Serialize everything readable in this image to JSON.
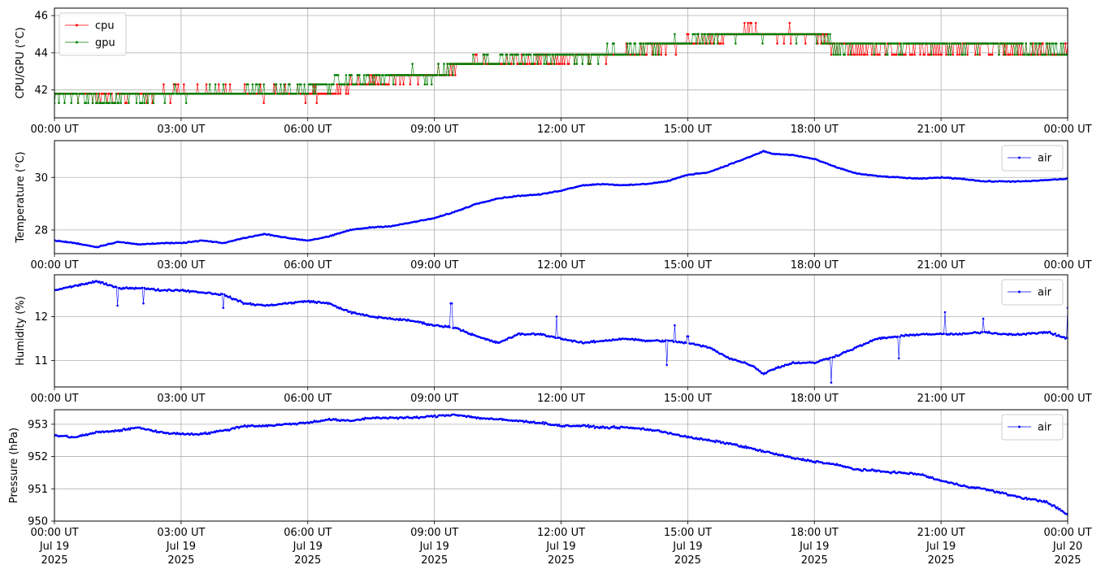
{
  "chart_data": [
    {
      "type": "line",
      "ylabel": "CPU/GPU (°C)",
      "xlim": [
        "2025-07-19 00:00",
        "2025-07-20 00:00"
      ],
      "ylim": [
        40.5,
        46.4
      ],
      "yticks": [
        "42",
        "44",
        "46"
      ],
      "xticks": [
        "00:00 UT",
        "03:00 UT",
        "06:00 UT",
        "09:00 UT",
        "12:00 UT",
        "15:00 UT",
        "18:00 UT",
        "21:00 UT",
        "00:00 UT"
      ],
      "grid": true,
      "legend_position": "upper-left",
      "series": [
        {
          "name": "cpu",
          "color": "#ff0000",
          "x_hours": [
            0,
            1,
            2,
            3,
            4,
            5,
            6,
            6.5,
            7,
            8,
            9,
            9.5,
            10,
            11,
            12,
            13,
            14,
            15,
            16,
            16.5,
            17,
            18,
            18.5,
            19,
            20,
            21,
            22,
            23,
            24
          ],
          "values": [
            41.8,
            41.6,
            41.7,
            41.9,
            41.9,
            41.8,
            41.8,
            41.8,
            42.4,
            42.6,
            42.8,
            43.2,
            43.5,
            43.6,
            43.7,
            43.8,
            44.2,
            44.6,
            44.9,
            45.2,
            45.0,
            45.0,
            44.3,
            44.2,
            44.2,
            44.2,
            44.3,
            44.1,
            44.1
          ],
          "range": [
            41.3,
            46.0
          ]
        },
        {
          "name": "gpu",
          "color": "#008000",
          "x_hours": [
            0,
            1,
            2,
            3,
            4,
            5,
            6,
            6.5,
            7,
            8,
            9,
            9.5,
            10,
            11,
            12,
            13,
            14,
            15,
            16,
            16.5,
            17,
            18,
            18.5,
            19,
            20,
            21,
            22,
            23,
            24
          ],
          "values": [
            41.7,
            41.5,
            41.6,
            41.8,
            41.9,
            42.0,
            42.0,
            42.3,
            42.5,
            42.7,
            42.8,
            43.3,
            43.6,
            43.7,
            43.8,
            43.9,
            44.3,
            44.7,
            45.0,
            45.0,
            45.0,
            45.0,
            44.3,
            44.3,
            44.4,
            44.4,
            44.4,
            44.3,
            44.1
          ],
          "range": [
            40.9,
            45.6
          ]
        }
      ]
    },
    {
      "type": "line",
      "ylabel": "Temperature (°C)",
      "xlim": [
        "2025-07-19 00:00",
        "2025-07-20 00:00"
      ],
      "ylim": [
        27.1,
        31.4
      ],
      "yticks": [
        "28",
        "30"
      ],
      "xticks": [
        "00:00 UT",
        "03:00 UT",
        "06:00 UT",
        "09:00 UT",
        "12:00 UT",
        "15:00 UT",
        "18:00 UT",
        "21:00 UT",
        "00:00 UT"
      ],
      "grid": true,
      "legend_position": "upper-right",
      "series": [
        {
          "name": "air",
          "color": "#0000ff",
          "x_hours": [
            0,
            0.5,
            1,
            1.5,
            2,
            2.5,
            3,
            3.5,
            4,
            4.5,
            5,
            5.5,
            6,
            6.5,
            7,
            7.5,
            8,
            8.5,
            9,
            9.5,
            10,
            10.5,
            11,
            11.5,
            12,
            12.5,
            13,
            13.5,
            14,
            14.5,
            15,
            15.5,
            16,
            16.5,
            16.8,
            17,
            17.5,
            18,
            18.5,
            19,
            19.5,
            20,
            20.5,
            21,
            21.5,
            22,
            22.5,
            23,
            23.5,
            24
          ],
          "values": [
            27.6,
            27.5,
            27.35,
            27.55,
            27.45,
            27.5,
            27.5,
            27.6,
            27.5,
            27.7,
            27.85,
            27.7,
            27.6,
            27.75,
            28.0,
            28.1,
            28.15,
            28.3,
            28.45,
            28.7,
            29.0,
            29.2,
            29.3,
            29.35,
            29.5,
            29.7,
            29.75,
            29.7,
            29.75,
            29.85,
            30.1,
            30.2,
            30.5,
            30.8,
            31.0,
            30.9,
            30.85,
            30.7,
            30.4,
            30.15,
            30.05,
            30.0,
            29.95,
            30.0,
            29.95,
            29.85,
            29.85,
            29.85,
            29.9,
            29.95
          ]
        }
      ]
    },
    {
      "type": "line",
      "ylabel": "Humidity (%)",
      "xlim": [
        "2025-07-19 00:00",
        "2025-07-20 00:00"
      ],
      "ylim": [
        10.4,
        12.95
      ],
      "yticks": [
        "11",
        "12"
      ],
      "xticks": [
        "00:00 UT",
        "03:00 UT",
        "06:00 UT",
        "09:00 UT",
        "12:00 UT",
        "15:00 UT",
        "18:00 UT",
        "21:00 UT",
        "00:00 UT"
      ],
      "grid": true,
      "legend_position": "upper-right",
      "series": [
        {
          "name": "air",
          "color": "#0000ff",
          "x_hours": [
            0,
            0.5,
            1,
            1.5,
            2,
            2.5,
            3,
            3.5,
            4,
            4.5,
            5,
            5.5,
            6,
            6.5,
            7,
            7.5,
            8,
            8.5,
            9,
            9.5,
            10,
            10.5,
            11,
            11.5,
            12,
            12.5,
            13,
            13.5,
            14,
            14.5,
            15,
            15.5,
            16,
            16.5,
            16.8,
            17,
            17.5,
            18,
            18.5,
            19,
            19.5,
            20,
            20.5,
            21,
            21.5,
            22,
            22.5,
            23,
            23.5,
            24
          ],
          "values": [
            12.6,
            12.7,
            12.8,
            12.65,
            12.65,
            12.6,
            12.6,
            12.55,
            12.5,
            12.3,
            12.25,
            12.3,
            12.35,
            12.3,
            12.1,
            12.0,
            11.95,
            11.9,
            11.8,
            11.75,
            11.55,
            11.4,
            11.6,
            11.6,
            11.5,
            11.4,
            11.45,
            11.5,
            11.45,
            11.45,
            11.4,
            11.3,
            11.05,
            10.9,
            10.7,
            10.8,
            10.95,
            10.95,
            11.1,
            11.3,
            11.5,
            11.55,
            11.6,
            11.6,
            11.6,
            11.65,
            11.6,
            11.6,
            11.65,
            11.5
          ],
          "spikes": [
            [
              1.5,
              12.25
            ],
            [
              2.1,
              12.3
            ],
            [
              4.0,
              12.2
            ],
            [
              9.4,
              12.3
            ],
            [
              11.9,
              12.0
            ],
            [
              14.5,
              10.9
            ],
            [
              14.7,
              11.8
            ],
            [
              15.0,
              11.55
            ],
            [
              18.4,
              10.5
            ],
            [
              20.0,
              11.05
            ],
            [
              21.1,
              12.1
            ],
            [
              22.0,
              11.95
            ],
            [
              24,
              12.2
            ]
          ]
        }
      ]
    },
    {
      "type": "line",
      "ylabel": "Pressure (hPa)",
      "xlim": [
        "2025-07-19 00:00",
        "2025-07-20 00:00"
      ],
      "ylim": [
        950.0,
        953.45
      ],
      "yticks": [
        "950",
        "951",
        "952",
        "953"
      ],
      "xticks": [
        "00:00 UT",
        "03:00 UT",
        "06:00 UT",
        "09:00 UT",
        "12:00 UT",
        "15:00 UT",
        "18:00 UT",
        "21:00 UT",
        "00:00 UT"
      ],
      "xticks_date": [
        "Jul 19",
        "Jul 19",
        "Jul 19",
        "Jul 19",
        "Jul 19",
        "Jul 19",
        "Jul 19",
        "Jul 19",
        "Jul 20"
      ],
      "xticks_year": [
        "2025",
        "2025",
        "2025",
        "2025",
        "2025",
        "2025",
        "2025",
        "2025",
        "2025"
      ],
      "grid": true,
      "legend_position": "upper-right",
      "series": [
        {
          "name": "air",
          "color": "#0000ff",
          "x_hours": [
            0,
            0.5,
            1,
            1.5,
            2,
            2.5,
            3,
            3.5,
            4,
            4.5,
            5,
            5.5,
            6,
            6.5,
            7,
            7.5,
            8,
            8.5,
            9,
            9.5,
            10,
            10.5,
            11,
            11.5,
            12,
            12.5,
            13,
            13.5,
            14,
            14.5,
            15,
            15.5,
            16,
            16.5,
            17,
            17.5,
            18,
            18.5,
            19,
            19.5,
            20,
            20.5,
            21,
            21.5,
            22,
            22.5,
            23,
            23.5,
            24
          ],
          "values": [
            952.65,
            952.6,
            952.75,
            952.8,
            952.9,
            952.75,
            952.7,
            952.7,
            952.8,
            952.95,
            952.95,
            953.0,
            953.05,
            953.15,
            953.1,
            953.2,
            953.2,
            953.2,
            953.25,
            953.3,
            953.2,
            953.15,
            953.1,
            953.05,
            952.95,
            952.95,
            952.9,
            952.9,
            952.85,
            952.75,
            952.6,
            952.5,
            952.4,
            952.25,
            952.1,
            951.95,
            951.85,
            951.75,
            951.6,
            951.55,
            951.5,
            951.45,
            951.25,
            951.1,
            951.0,
            950.85,
            950.7,
            950.6,
            950.2
          ]
        }
      ]
    }
  ]
}
